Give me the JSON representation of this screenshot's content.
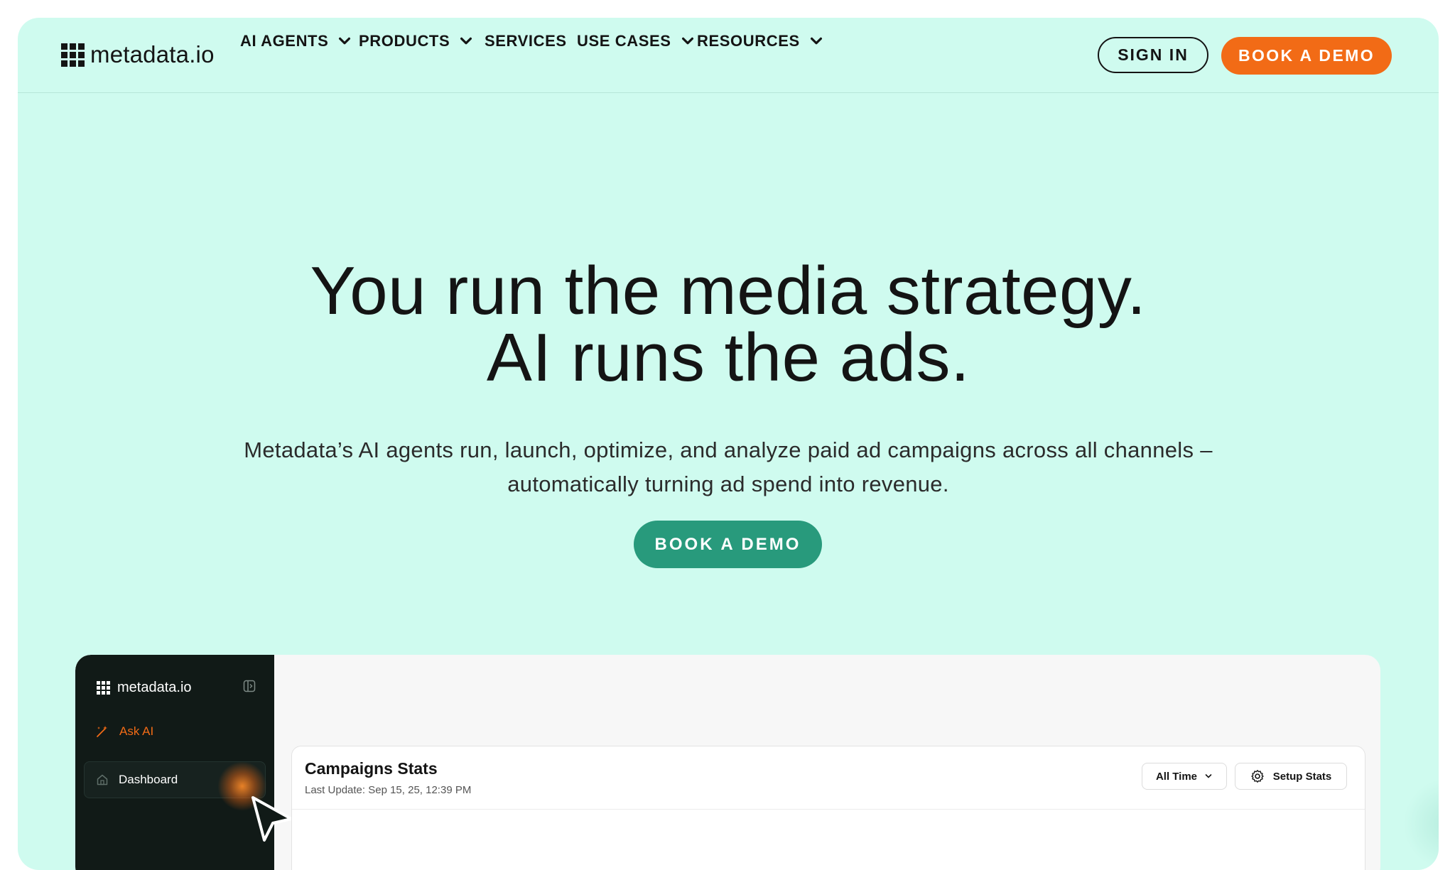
{
  "nav": {
    "logo_text": "metadata.io",
    "items": [
      {
        "label": "AI AGENTS",
        "has_dropdown": true
      },
      {
        "label": "PRODUCTS",
        "has_dropdown": true
      },
      {
        "label": "SERVICES",
        "has_dropdown": false
      },
      {
        "label": "USE CASES",
        "has_dropdown": true
      },
      {
        "label": "RESOURCES",
        "has_dropdown": true
      }
    ],
    "sign_in": "SIGN IN",
    "book_demo": "BOOK A DEMO"
  },
  "hero": {
    "title_line1": "You run the media strategy.",
    "title_line2": "AI runs the ads.",
    "subtitle_line1": "Metadata’s AI agents run, launch, optimize, and analyze paid ad campaigns across all channels –",
    "subtitle_line2": "automatically turning ad spend into revenue.",
    "cta": "BOOK A DEMO"
  },
  "preview": {
    "sidebar": {
      "logo_text": "metadata.io",
      "ask_ai": "Ask AI",
      "dashboard": "Dashboard"
    },
    "stats": {
      "title": "Campaigns Stats",
      "last_update": "Last Update: Sep 15, 25, 12:39 PM",
      "range": "All Time",
      "setup": "Setup Stats"
    }
  },
  "colors": {
    "background": "#cffbef",
    "accent_orange": "#f26b16",
    "accent_green": "#289a7c",
    "sidebar_dark": "#111a17"
  }
}
